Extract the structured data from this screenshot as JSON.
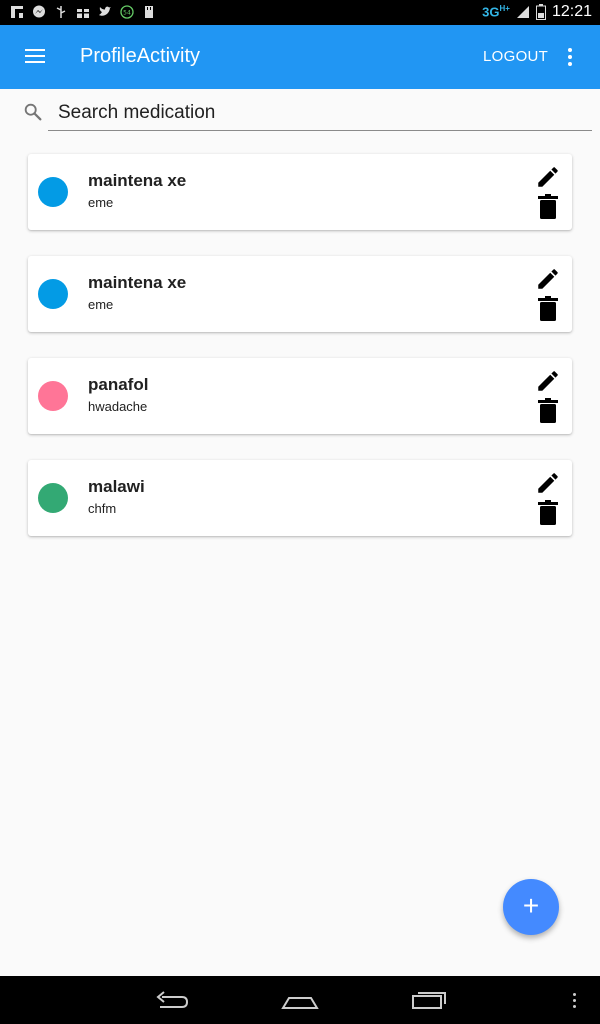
{
  "status_bar": {
    "network": "3G",
    "network_sup": "H+",
    "time": "12:21",
    "badge": "54",
    "icons": [
      "flipboard-icon",
      "messenger-icon",
      "usb-icon",
      "gift-icon",
      "twitter-icon",
      "data-usage-icon",
      "storage-icon"
    ]
  },
  "app_bar": {
    "title": "ProfileActivity",
    "logout_label": "LOGOUT",
    "color": "#2196f3"
  },
  "search": {
    "placeholder": "Search medication",
    "value": ""
  },
  "medications": [
    {
      "name": "maintena xe",
      "description": "eme",
      "color": "#039be5"
    },
    {
      "name": "maintena xe",
      "description": "eme",
      "color": "#039be5"
    },
    {
      "name": "panafol",
      "description": "hwadache",
      "color": "#ff7597"
    },
    {
      "name": "malawi",
      "description": "chfm",
      "color": "#33a974"
    }
  ],
  "fab": {
    "label": "+",
    "color": "#448aff"
  }
}
